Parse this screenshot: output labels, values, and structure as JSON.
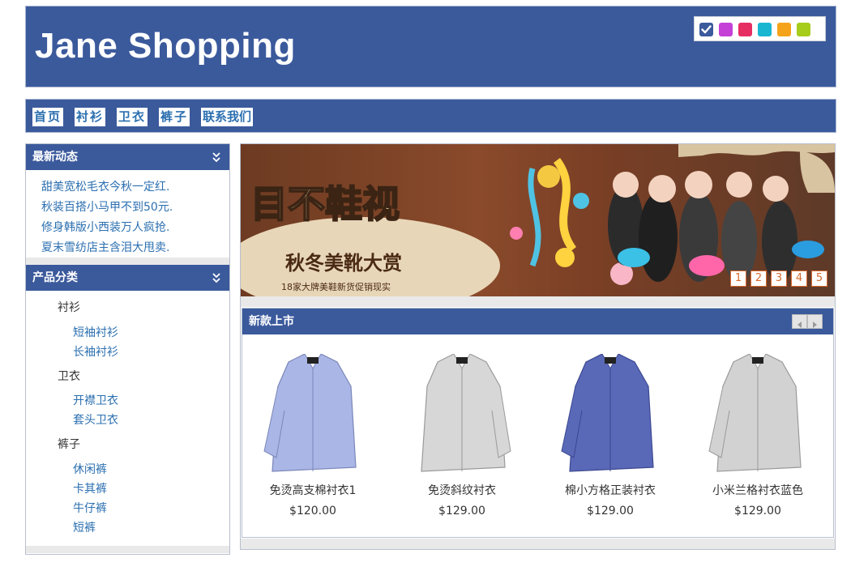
{
  "site": {
    "title": "Jane Shopping"
  },
  "skins": {
    "colors": [
      "#3b5a9c",
      "#c440d6",
      "#e62e63",
      "#19b6d2",
      "#f6a31c",
      "#a6cc1c"
    ],
    "selected_index": 0
  },
  "nav": {
    "items": [
      {
        "label": "首页"
      },
      {
        "label": "衬衫"
      },
      {
        "label": "卫衣"
      },
      {
        "label": "裤子"
      },
      {
        "label": "联系我们"
      }
    ]
  },
  "news": {
    "title": "最新动态",
    "items": [
      {
        "label": "甜美宽松毛衣今秋一定红."
      },
      {
        "label": "秋装百搭小马甲不到50元."
      },
      {
        "label": "修身韩版小西装万人疯抢."
      },
      {
        "label": "夏末雪纺店主含泪大甩卖."
      }
    ]
  },
  "categories": {
    "title": "产品分类",
    "groups": [
      {
        "label": "衬衫",
        "items": [
          {
            "label": "短袖衬衫"
          },
          {
            "label": "长袖衬衫"
          }
        ]
      },
      {
        "label": "卫衣",
        "items": [
          {
            "label": "开襟卫衣"
          },
          {
            "label": "套头卫衣"
          }
        ]
      },
      {
        "label": "裤子",
        "items": [
          {
            "label": "休闲裤"
          },
          {
            "label": "卡其裤"
          },
          {
            "label": "牛仔裤"
          },
          {
            "label": "短裤"
          }
        ]
      }
    ]
  },
  "banner": {
    "headline": "目不鞋视",
    "subtitle": "秋冬美靴大赏",
    "tagline": "18家大牌美鞋新货促销现实",
    "pages": [
      "1",
      "2",
      "3",
      "4",
      "5"
    ],
    "active_page": 0
  },
  "new_arrivals": {
    "title": "新款上市",
    "products": [
      {
        "name": "免烫高支棉衬衣1",
        "price": "$120.00",
        "color": "#a9b6e6"
      },
      {
        "name": "免烫斜纹衬衣",
        "price": "$129.00",
        "color": "#d7d7d7"
      },
      {
        "name": "棉小方格正装衬衣",
        "price": "$129.00",
        "color": "#5a68b8"
      },
      {
        "name": "小米兰格衬衣蓝色",
        "price": "$129.00",
        "color": "#d2d2d2"
      }
    ]
  }
}
